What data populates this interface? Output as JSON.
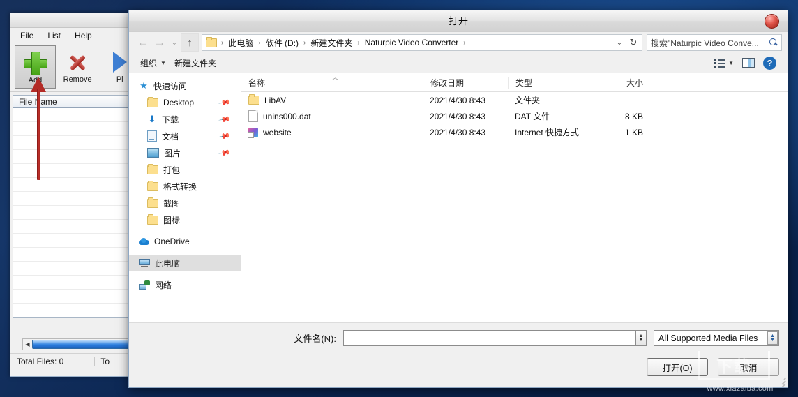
{
  "desktop": {
    "bg_color": "#0b2a5c"
  },
  "app_window": {
    "menu": [
      "File",
      "List",
      "Help"
    ],
    "toolbar": [
      {
        "label": "Add",
        "icon": "plus-icon",
        "selected": true
      },
      {
        "label": "Remove",
        "icon": "x-icon",
        "selected": false
      },
      {
        "label": "Pl",
        "icon": "play-icon",
        "selected": false
      }
    ],
    "list_header": "File Name",
    "status": {
      "total_files": "Total Files: 0",
      "second": "To"
    }
  },
  "annotation": {
    "type": "red-arrow",
    "points_to": "Add"
  },
  "dialog": {
    "title": "打开",
    "close_label": "×",
    "nav": {
      "back": "←",
      "forward": "→",
      "recent": "⌄",
      "up": "↑",
      "dropdown": "⌄",
      "refresh": "↻",
      "breadcrumbs": [
        "此电脑",
        "软件 (D:)",
        "新建文件夹",
        "Naturpic Video Converter"
      ],
      "separator": "›"
    },
    "search": {
      "value": "搜索\"Naturpic Video Conve...",
      "icon": "search-icon"
    },
    "command_bar": {
      "organize": "组织",
      "new_folder": "新建文件夹",
      "caret": "▼",
      "view_icon": "view-layout-icon",
      "pane_icon": "preview-pane-icon",
      "help_icon": "help-icon",
      "help_label": "?"
    },
    "nav_pane": [
      {
        "label": "快速访问",
        "icon": "star-icon",
        "indent": false,
        "pin": false,
        "selected": false
      },
      {
        "label": "Desktop",
        "icon": "folder-icon",
        "indent": true,
        "pin": true,
        "selected": false
      },
      {
        "label": "下载",
        "icon": "download-icon",
        "indent": true,
        "pin": true,
        "selected": false
      },
      {
        "label": "文档",
        "icon": "documents-icon",
        "indent": true,
        "pin": true,
        "selected": false
      },
      {
        "label": "图片",
        "icon": "pictures-icon",
        "indent": true,
        "pin": true,
        "selected": false
      },
      {
        "label": "打包",
        "icon": "folder-icon",
        "indent": true,
        "pin": false,
        "selected": false
      },
      {
        "label": "格式转换",
        "icon": "folder-icon",
        "indent": true,
        "pin": false,
        "selected": false
      },
      {
        "label": "截图",
        "icon": "folder-icon",
        "indent": true,
        "pin": false,
        "selected": false
      },
      {
        "label": "图标",
        "icon": "folder-icon",
        "indent": true,
        "pin": false,
        "selected": false
      },
      {
        "label": "OneDrive",
        "icon": "cloud-icon",
        "indent": false,
        "pin": false,
        "selected": false
      },
      {
        "label": "此电脑",
        "icon": "computer-icon",
        "indent": false,
        "pin": false,
        "selected": true
      },
      {
        "label": "网络",
        "icon": "network-icon",
        "indent": false,
        "pin": false,
        "selected": false
      }
    ],
    "columns": [
      "名称",
      "修改日期",
      "类型",
      "大小"
    ],
    "sort_marker": "︿",
    "files": [
      {
        "name": "LibAV",
        "icon": "folder-icon",
        "date": "2021/4/30 8:43",
        "type": "文件夹",
        "size": ""
      },
      {
        "name": "unins000.dat",
        "icon": "file-icon",
        "date": "2021/4/30 8:43",
        "type": "DAT 文件",
        "size": "8 KB"
      },
      {
        "name": "website",
        "icon": "shortcut-icon",
        "date": "2021/4/30 8:43",
        "type": "Internet 快捷方式",
        "size": "1 KB"
      }
    ],
    "filename": {
      "label": "文件名(N):",
      "value": "",
      "spinner_up": "▲",
      "spinner_down": "▼"
    },
    "filter": {
      "value": "All Supported Media Files",
      "up": "▲",
      "down": "▼"
    },
    "buttons": {
      "open": "打开(O)",
      "cancel": "取消"
    }
  },
  "watermark": {
    "logo": "下载",
    "url": "www.xiazaiba.com"
  }
}
